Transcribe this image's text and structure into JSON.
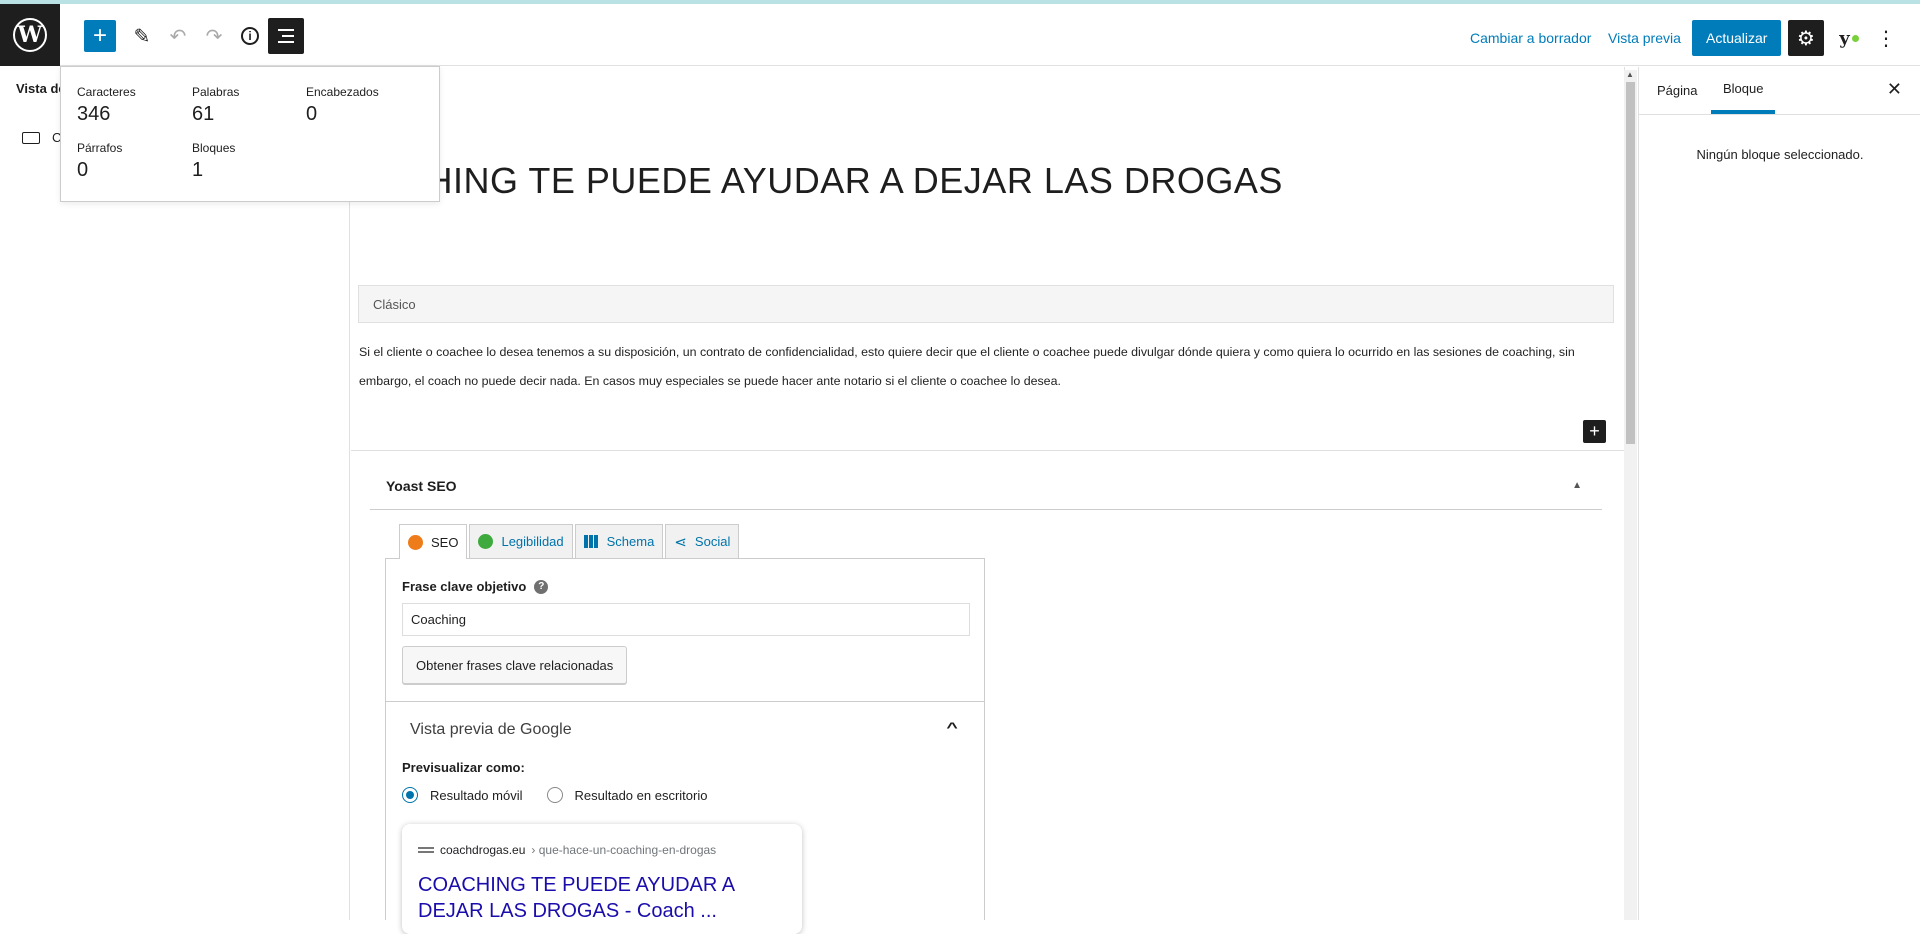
{
  "toolbar": {
    "draft_label": "Cambiar a borrador",
    "preview_label": "Vista previa",
    "update_label": "Actualizar"
  },
  "left_panel": {
    "title": "Vista de",
    "item_label": "C"
  },
  "info_popover": {
    "stats": [
      {
        "label": "Caracteres",
        "value": "346"
      },
      {
        "label": "Palabras",
        "value": "61"
      },
      {
        "label": "Encabezados",
        "value": "0"
      },
      {
        "label": "Párrafos",
        "value": "0"
      },
      {
        "label": "Bloques",
        "value": "1"
      }
    ]
  },
  "editor": {
    "title": "CHING TE PUEDE AYUDAR A DEJAR LAS DROGAS",
    "classic_label": "Clásico",
    "classic_text": "Si el cliente o coachee lo desea tenemos a su disposición, un contrato de confidencialidad, esto quiere decir que el cliente o coachee puede divulgar dónde quiera y como quiera lo ocurrido en las sesiones de coaching, sin embargo, el coach no puede decir nada. En casos muy especiales se puede hacer ante notario si el cliente o coachee lo desea."
  },
  "yoast": {
    "title": "Yoast SEO",
    "tabs": [
      {
        "label": "SEO",
        "icon": "orange-face-icon"
      },
      {
        "label": "Legibilidad",
        "icon": "green-face-icon"
      },
      {
        "label": "Schema",
        "icon": "grid-icon"
      },
      {
        "label": "Social",
        "icon": "share-icon"
      }
    ],
    "focus_keyphrase_label": "Frase clave objetivo",
    "focus_keyphrase_value": "Coaching",
    "related_button": "Obtener frases clave relacionadas",
    "google_preview_title": "Vista previa de Google",
    "preview_as_label": "Previsualizar como:",
    "radio_mobile": "Resultado móvil",
    "radio_desktop": "Resultado en escritorio",
    "serp": {
      "domain": "coachdrogas.eu",
      "path": "› que-hace-un-coaching-en-drogas",
      "title": "COACHING TE PUEDE AYUDAR A DEJAR LAS DROGAS - Coach ..."
    }
  },
  "right_panel": {
    "tab_page": "Página",
    "tab_block": "Bloque",
    "no_block": "Ningún bloque seleccionado."
  },
  "colors": {
    "accent": "#007cba",
    "dark": "#1e1e1e",
    "seo_orange": "#ee7c1b",
    "readability_green": "#3eaa3e",
    "serp_link": "#1a0dab"
  }
}
